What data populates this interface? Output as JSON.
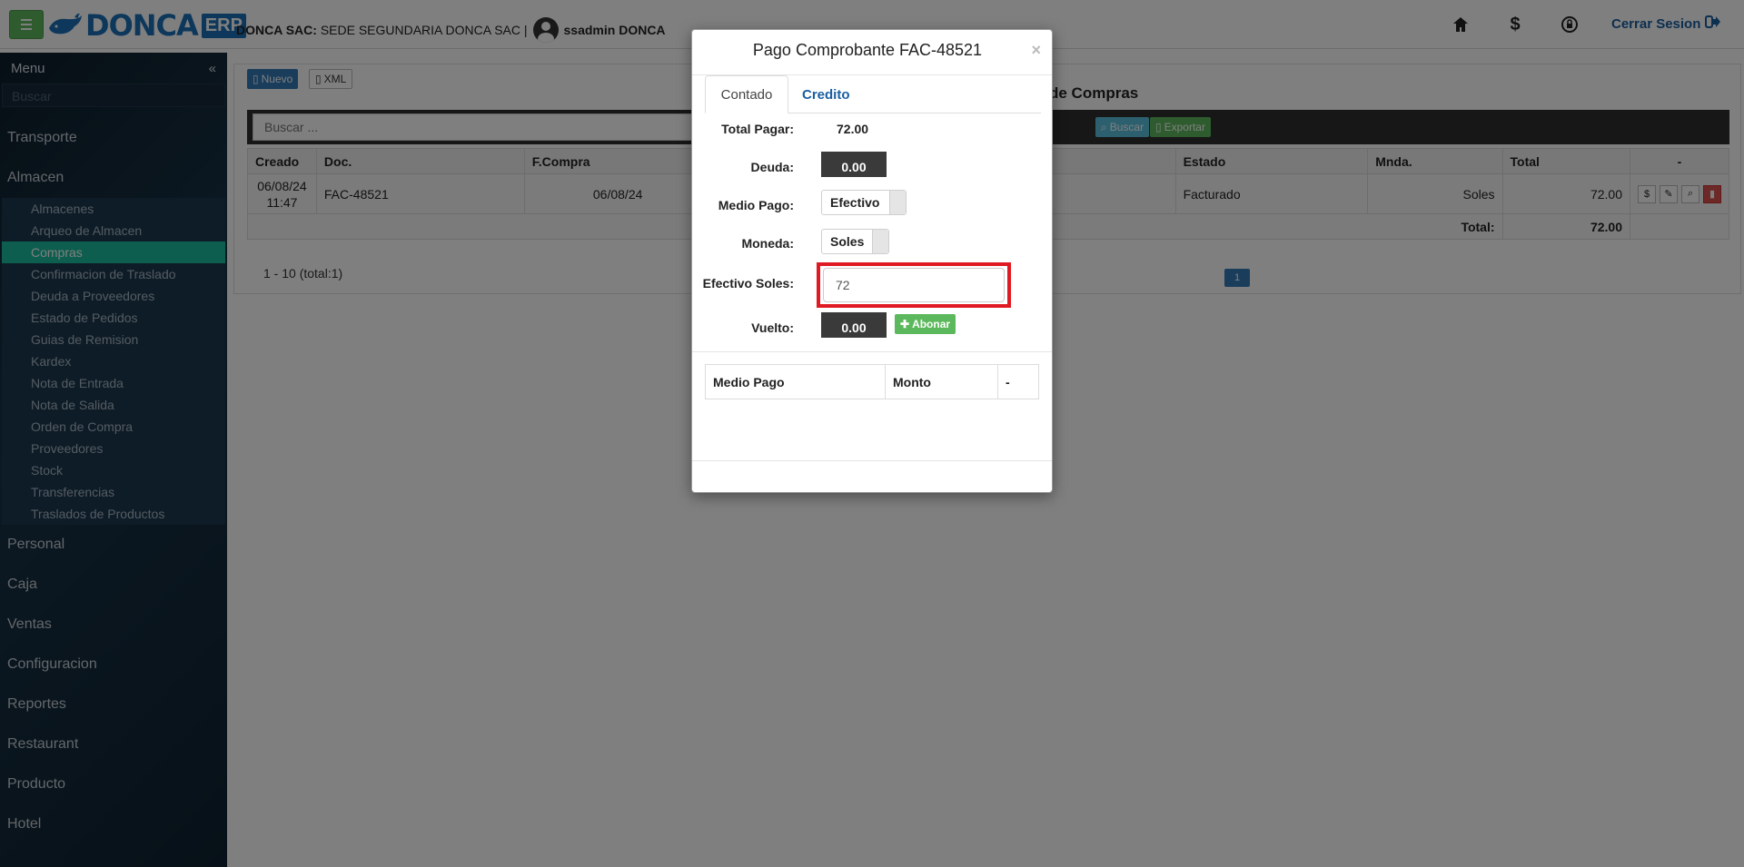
{
  "header": {
    "logo_text": "DONCA",
    "logo_badge": "ERP",
    "company_bold": "DONCA SAC:",
    "company_rest": "SEDE SEGUNDARIA DONCA SAC |",
    "user": "ssadmin DONCA",
    "logout_label": "Cerrar Sesion",
    "icons": [
      "home-icon",
      "dollar-icon",
      "lock-icon",
      "logout-icon"
    ]
  },
  "sidebar": {
    "title": "Menu",
    "collapse_glyph": "«",
    "search_placeholder": "Buscar",
    "sections_before": [
      "Transporte",
      "Almacen"
    ],
    "submenu": [
      "Almacenes",
      "Arqueo de Almacen",
      "Compras",
      "Confirmacion de Traslado",
      "Deuda a Proveedores",
      "Estado de Pedidos",
      "Guias de Remision",
      "Kardex",
      "Nota de Entrada",
      "Nota de Salida",
      "Orden de Compra",
      "Proveedores",
      "Stock",
      "Transferencias",
      "Traslados de Productos"
    ],
    "active_item": "Compras",
    "sections_after": [
      "Personal",
      "Caja",
      "Ventas",
      "Configuracion",
      "Reportes",
      "Restaurant",
      "Producto",
      "Hotel"
    ]
  },
  "main": {
    "btn_nuevo": "Nuevo",
    "btn_xml": "XML",
    "title_visible": "de Compras",
    "search_placeholder": "Buscar ...",
    "btn_buscar": "Buscar",
    "btn_exportar": "Exportar",
    "columns": {
      "creado": "Creado",
      "doc": "Doc.",
      "fcompra": "F.Compra",
      "estado": "Estado",
      "mnda": "Mnda.",
      "total": "Total",
      "actions": "-"
    },
    "row": {
      "creado_date": "06/08/24",
      "creado_time": "11:47",
      "doc": "FAC-48521",
      "fcompra": "06/08/24",
      "estado": "Facturado",
      "mnda": "Soles",
      "total": "72.00"
    },
    "footer_total_label": "Total:",
    "footer_total_value": "72.00",
    "pager_info": "1 - 10 (total:1)",
    "page_number": "1"
  },
  "modal": {
    "title": "Pago Comprobante FAC-48521",
    "close_glyph": "×",
    "tabs": [
      "Contado",
      "Credito"
    ],
    "total_pagar_label": "Total Pagar:",
    "total_pagar_value": "72.00",
    "deuda_label": "Deuda:",
    "deuda_value": "0.00",
    "medio_pago_label": "Medio Pago:",
    "medio_pago_value": "Efectivo",
    "moneda_label": "Moneda:",
    "moneda_value": "Soles",
    "efectivo_label": "Efectivo Soles:",
    "efectivo_value": "72",
    "vuelto_label": "Vuelto:",
    "vuelto_value": "0.00",
    "abonar_label": "Abonar",
    "table_headers": [
      "Medio Pago",
      "Monto",
      "-"
    ],
    "highlight_color": "#e01a22"
  },
  "colors": {
    "accent": "#1abc9c",
    "brand": "#1b70b7",
    "primary": "#337ab7",
    "success": "#5cb85c",
    "danger": "#d9534f"
  }
}
